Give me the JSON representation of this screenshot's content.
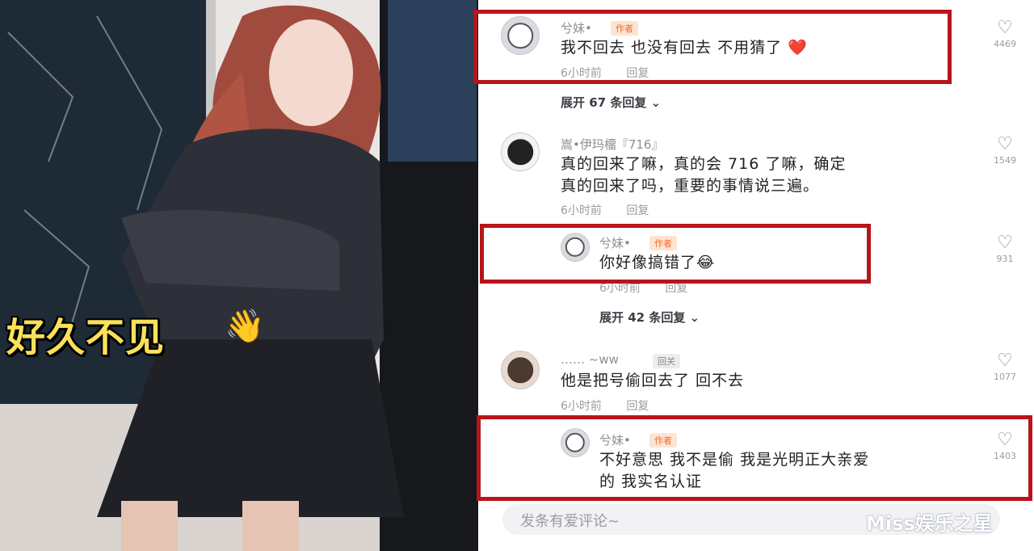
{
  "photo": {
    "caption": "好久不见",
    "caption_emoji": "👋"
  },
  "comments": [
    {
      "username": "兮妹•",
      "badge": "作者",
      "text_lines": [
        "我不回去 也没有回去 不用猜了 ❤️"
      ],
      "time": "6小时前",
      "reply_label": "回复",
      "likes": "4469",
      "expand": "展开 67 条回复 ⌄"
    },
    {
      "username": "嵩•伊玛橊『716』",
      "text_lines": [
        "真的回来了嘛，真的会 716 了嘛，确定",
        "真的回来了吗，重要的事情说三遍。"
      ],
      "time": "6小时前",
      "reply_label": "回复",
      "likes": "1549"
    },
    {
      "username": "兮妹•",
      "badge": "作者",
      "text_lines": [
        "你好像搞错了😂"
      ],
      "time": "6小时前",
      "reply_label": "回复",
      "likes": "931",
      "expand": "展开 42 条回复 ⌄"
    },
    {
      "username": "……  ~ww",
      "badge": "回关",
      "text_lines": [
        "他是把号偷回去了 回不去"
      ],
      "time": "6小时前",
      "reply_label": "回复",
      "likes": "1077"
    },
    {
      "username": "兮妹•",
      "badge": "作者",
      "text_lines": [
        "不好意思 我不是偷 我是光明正大亲爱",
        "的 我实名认证"
      ],
      "likes": "1403"
    }
  ],
  "input": {
    "placeholder": "发条有爱评论~"
  },
  "watermark": "Miss娱乐之星",
  "colors": {
    "highlight": "#b8151b",
    "author_badge": "#f06a2a"
  },
  "icons": {
    "like": "heart-outline-icon",
    "expand": "chevron-down-icon"
  }
}
